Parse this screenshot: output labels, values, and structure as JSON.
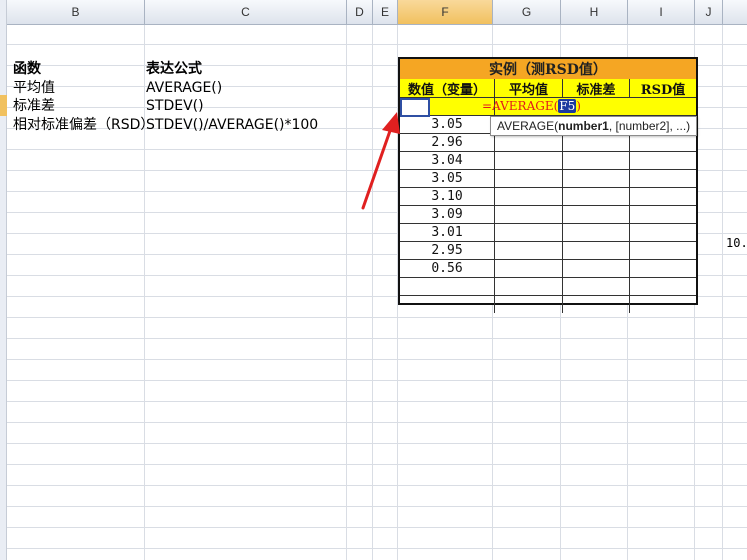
{
  "columns": [
    "B",
    "C",
    "D",
    "E",
    "F",
    "G",
    "H",
    "I",
    "J"
  ],
  "left_table": {
    "headers": {
      "function": "函数",
      "formula": "表达公式"
    },
    "rows": [
      {
        "name": "平均值",
        "formula": "AVERAGE()"
      },
      {
        "name": "标准差",
        "formula": "STDEV()"
      },
      {
        "name": "相对标准偏差（RSD）",
        "formula": "STDEV()/AVERAGE()*100"
      }
    ]
  },
  "example": {
    "title": "实例（测RSD值）",
    "headers": [
      "数值（变量）",
      "平均值",
      "标准差",
      "RSD值"
    ],
    "formula_prefix": "=AVERAGE(",
    "formula_ref": "F5",
    "formula_suffix": ")",
    "values": [
      "3.05",
      "2.96",
      "3.04",
      "3.05",
      "3.10",
      "3.09",
      "3.01",
      "2.95",
      "0.56"
    ]
  },
  "tooltip": {
    "func": "AVERAGE(",
    "arg1": "number1",
    "rest": ", [number2], ...)"
  },
  "partial_value": "10.",
  "colors": {
    "title_bg": "#f5a623",
    "header_bg": "#ffff00",
    "formula_text": "#e21b1b",
    "arrow": "#e02020"
  }
}
